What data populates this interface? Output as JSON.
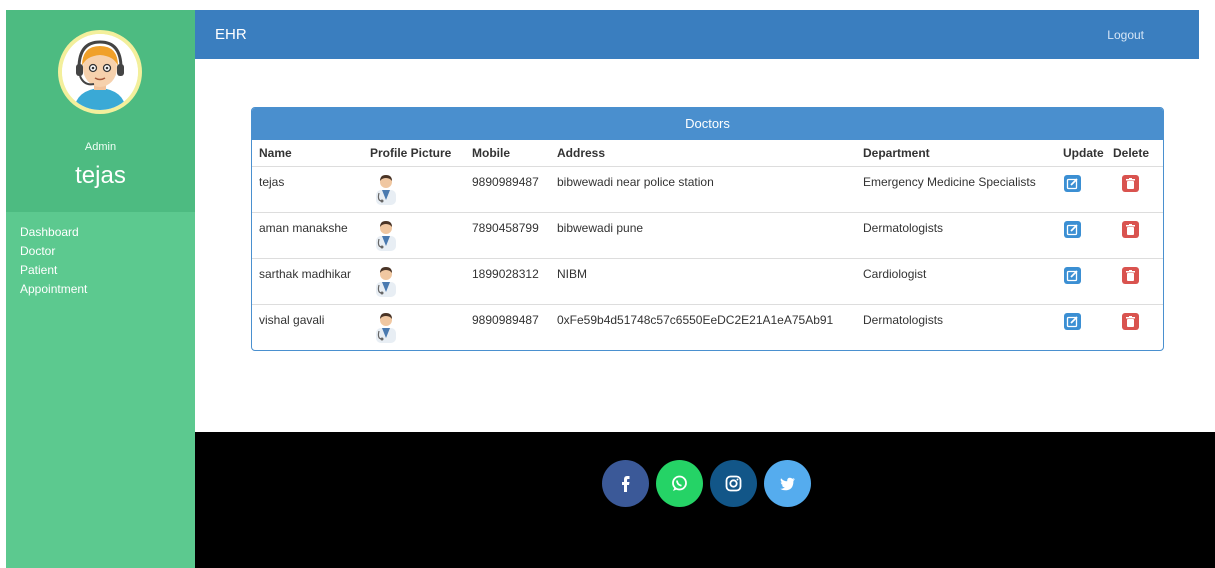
{
  "app": {
    "brand": "EHR",
    "logout_label": "Logout"
  },
  "user": {
    "role": "Admin",
    "name": "tejas"
  },
  "sidebar": {
    "items": [
      {
        "label": "Dashboard"
      },
      {
        "label": "Doctor"
      },
      {
        "label": "Patient"
      },
      {
        "label": "Appointment"
      }
    ]
  },
  "doctors": {
    "title": "Doctors",
    "columns": [
      "Name",
      "Profile Picture",
      "Mobile",
      "Address",
      "Department",
      "Update",
      "Delete"
    ],
    "rows": [
      {
        "name": "tejas",
        "mobile": "9890989487",
        "address": "bibwewadi near police station",
        "department": "Emergency Medicine Specialists"
      },
      {
        "name": "aman manakshe",
        "mobile": "7890458799",
        "address": "bibwewadi pune",
        "department": "Dermatologists"
      },
      {
        "name": "sarthak madhikar",
        "mobile": "1899028312",
        "address": "NIBM",
        "department": "Cardiologist"
      },
      {
        "name": "vishal gavali",
        "mobile": "9890989487",
        "address": "0xFe59b4d51748c57c6550EeDC2E21A1eA75Ab91",
        "department": "Dermatologists"
      }
    ]
  },
  "footer": {
    "social": [
      {
        "icon": "facebook-icon",
        "color": "#3b5998"
      },
      {
        "icon": "whatsapp-icon",
        "color": "#25d366"
      },
      {
        "icon": "instagram-icon",
        "color": "#125688"
      },
      {
        "icon": "twitter-icon",
        "color": "#55acee"
      }
    ]
  }
}
